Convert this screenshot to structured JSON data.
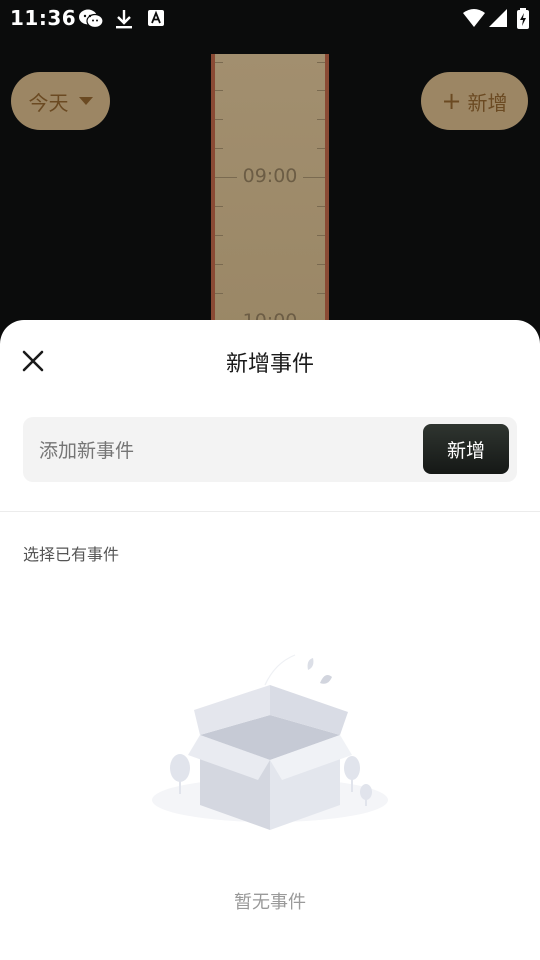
{
  "status_bar": {
    "time": "11:36"
  },
  "app": {
    "date_selector_label": "今天",
    "add_button_label": "新增",
    "ruler_labels": [
      "09:00",
      "10:00"
    ]
  },
  "sheet": {
    "title": "新增事件",
    "input_placeholder": "添加新事件",
    "add_button_label": "新增",
    "section_label": "选择已有事件",
    "empty_text": "暂无事件"
  }
}
